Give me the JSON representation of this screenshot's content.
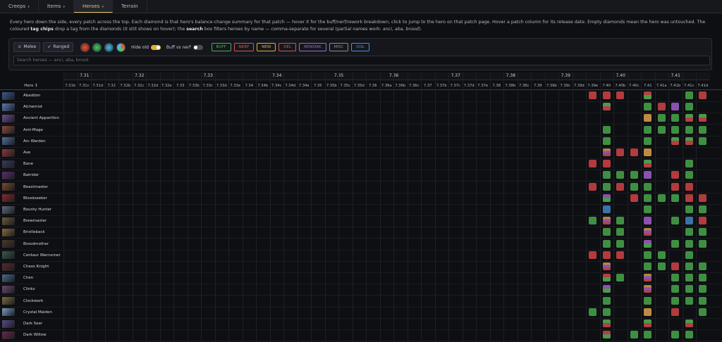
{
  "nav": {
    "tabs": [
      {
        "label": "Creeps",
        "caret": "▾"
      },
      {
        "label": "Items",
        "caret": "▾"
      },
      {
        "label": "Heroes",
        "caret": "▾"
      },
      {
        "label": "Terrain",
        "caret": ""
      }
    ]
  },
  "description": {
    "p1": "Every hero down the side, every patch across the top. Each diamond is that hero's balance-change summary for that patch — hover it for the buff/nerf/rework breakdown, click to jump to the hero on that patch page. Hover a patch column for its release date. Empty diamonds mean the hero was untouched. The coloured",
    "b1": "tag chips",
    "p2": "drop a tag from the diamonds (it still shows on hover); the",
    "b2": "search",
    "p3": "box filters heroes by name — comma-separate for several (partial names work:",
    "examples": "anci, aba, brood",
    "p4": ")."
  },
  "filters": {
    "melee": "Melee",
    "ranged": "Ranged",
    "hide_old": "Hide old",
    "buff_vs_nerf": "Buff vs nerf",
    "chips": [
      {
        "label": "BUFF",
        "color": "#4caf50"
      },
      {
        "label": "NERF",
        "color": "#d9534f"
      },
      {
        "label": "NEW",
        "color": "#e0b030"
      },
      {
        "label": "DEL",
        "color": "#d9534f"
      },
      {
        "label": "REWORK",
        "color": "#9b6bd0"
      },
      {
        "label": "MISC",
        "color": "#8a8d95"
      },
      {
        "label": "QOL",
        "color": "#4a90d9"
      }
    ],
    "search_placeholder": "Search heroes — anci, aba, brood"
  },
  "hero_header": "Hero ↕",
  "majors": [
    "7.31",
    "7.32",
    "7.33",
    "7.34",
    "7.35",
    "7.36",
    "7.37",
    "7.38",
    "7.39",
    "7.40",
    "7.41"
  ],
  "patches": [
    "7.31b",
    "7.31c",
    "7.31d",
    "7.32",
    "7.32b",
    "7.32c",
    "7.32d",
    "7.32e",
    "7.33",
    "7.33b",
    "7.33c",
    "7.33d",
    "7.33e",
    "7.34",
    "7.34b",
    "7.34c",
    "7.34d",
    "7.34e",
    "7.35",
    "7.35b",
    "7.35c",
    "7.35d",
    "7.36",
    "7.36a",
    "7.36b",
    "7.36c",
    "7.37",
    "7.37b",
    "7.37c",
    "7.37d",
    "7.37e",
    "7.38",
    "7.38b",
    "7.38c",
    "7.39",
    "7.39b",
    "7.39c",
    "7.39d",
    "7.39e",
    "7.40",
    "7.40b",
    "7.40c",
    "7.41",
    "7.41a",
    "7.41b",
    "7.41c",
    "7.41d"
  ],
  "heroes": [
    {
      "name": "Abaddon",
      "cells": [
        [
          "7.39e",
          "r"
        ],
        [
          "7.40",
          "r"
        ],
        [
          "7.40b",
          "r"
        ],
        [
          "7.41",
          "rg"
        ],
        [
          "7.41c",
          "g"
        ],
        [
          "7.41d",
          "r"
        ]
      ]
    },
    {
      "name": "Alchemist",
      "cells": [
        [
          "7.40",
          "gr"
        ],
        [
          "7.41",
          "g"
        ],
        [
          "7.41a",
          "r"
        ],
        [
          "7.41b",
          "p"
        ],
        [
          "7.41c",
          "g"
        ]
      ]
    },
    {
      "name": "Ancient Apparition",
      "cells": [
        [
          "7.41",
          "t"
        ],
        [
          "7.41a",
          "g"
        ],
        [
          "7.41b",
          "g"
        ],
        [
          "7.41c",
          "gr"
        ],
        [
          "7.41d",
          "gr"
        ]
      ]
    },
    {
      "name": "Anti-Mage",
      "cells": [
        [
          "7.40",
          "g"
        ],
        [
          "7.41",
          "g"
        ],
        [
          "7.41a",
          "g"
        ],
        [
          "7.41b",
          "g"
        ],
        [
          "7.41c",
          "g"
        ],
        [
          "7.41d",
          "g"
        ]
      ]
    },
    {
      "name": "Arc Warden",
      "cells": [
        [
          "7.40",
          "g"
        ],
        [
          "7.41",
          "g"
        ],
        [
          "7.41b",
          "gr"
        ],
        [
          "7.41c",
          "gr"
        ],
        [
          "7.41d",
          "g"
        ]
      ]
    },
    {
      "name": "Axe",
      "cells": [
        [
          "7.40",
          "tri"
        ],
        [
          "7.40b",
          "r"
        ],
        [
          "7.40c",
          "r"
        ],
        [
          "7.41",
          "t"
        ]
      ]
    },
    {
      "name": "Bane",
      "cells": [
        [
          "7.39e",
          "r"
        ],
        [
          "7.40",
          "r"
        ],
        [
          "7.41",
          "gr"
        ],
        [
          "7.41c",
          "g"
        ]
      ]
    },
    {
      "name": "Batrider",
      "cells": [
        [
          "7.40",
          "g"
        ],
        [
          "7.40b",
          "g"
        ],
        [
          "7.40c",
          "g"
        ],
        [
          "7.41",
          "p"
        ],
        [
          "7.41b",
          "r"
        ],
        [
          "7.41c",
          "g"
        ]
      ]
    },
    {
      "name": "Beastmaster",
      "cells": [
        [
          "7.39e",
          "r"
        ],
        [
          "7.40",
          "g"
        ],
        [
          "7.40b",
          "r"
        ],
        [
          "7.40c",
          "g"
        ],
        [
          "7.41",
          "g"
        ],
        [
          "7.41b",
          "r"
        ],
        [
          "7.41c",
          "r"
        ]
      ]
    },
    {
      "name": "Bloodseeker",
      "cells": [
        [
          "7.40",
          "pg"
        ],
        [
          "7.40c",
          "r"
        ],
        [
          "7.41",
          "g"
        ],
        [
          "7.41a",
          "g"
        ],
        [
          "7.41b",
          "g"
        ],
        [
          "7.41c",
          "r"
        ],
        [
          "7.41d",
          "r"
        ]
      ]
    },
    {
      "name": "Bounty Hunter",
      "cells": [
        [
          "7.40",
          "b"
        ],
        [
          "7.41",
          "g"
        ],
        [
          "7.41c",
          "g"
        ],
        [
          "7.41d",
          "g"
        ]
      ]
    },
    {
      "name": "Brewmaster",
      "cells": [
        [
          "7.39e",
          "g"
        ],
        [
          "7.40",
          "tri"
        ],
        [
          "7.40b",
          "g"
        ],
        [
          "7.41",
          "p"
        ],
        [
          "7.41b",
          "g"
        ],
        [
          "7.41c",
          "b"
        ],
        [
          "7.41d",
          "r"
        ]
      ]
    },
    {
      "name": "Bristleback",
      "cells": [
        [
          "7.40",
          "g"
        ],
        [
          "7.40b",
          "g"
        ],
        [
          "7.41",
          "tri"
        ],
        [
          "7.41c",
          "g"
        ],
        [
          "7.41d",
          "g"
        ]
      ]
    },
    {
      "name": "Broodmother",
      "cells": [
        [
          "7.40",
          "g"
        ],
        [
          "7.40b",
          "g"
        ],
        [
          "7.41",
          "pg"
        ],
        [
          "7.41b",
          "g"
        ],
        [
          "7.41c",
          "g"
        ],
        [
          "7.41d",
          "g"
        ]
      ]
    },
    {
      "name": "Centaur Warrunner",
      "cells": [
        [
          "7.39e",
          "r"
        ],
        [
          "7.40",
          "r"
        ],
        [
          "7.40b",
          "r"
        ],
        [
          "7.41",
          "g"
        ],
        [
          "7.41a",
          "g"
        ],
        [
          "7.41c",
          "g"
        ]
      ]
    },
    {
      "name": "Chaos Knight",
      "cells": [
        [
          "7.40",
          "tri"
        ],
        [
          "7.41",
          "g"
        ],
        [
          "7.41a",
          "g"
        ],
        [
          "7.41b",
          "r"
        ],
        [
          "7.41c",
          "g"
        ],
        [
          "7.41d",
          "g"
        ]
      ]
    },
    {
      "name": "Chen",
      "cells": [
        [
          "7.40",
          "rg"
        ],
        [
          "7.40b",
          "g"
        ],
        [
          "7.41",
          "tri"
        ],
        [
          "7.41b",
          "g"
        ],
        [
          "7.41c",
          "g"
        ],
        [
          "7.41d",
          "g"
        ]
      ]
    },
    {
      "name": "Clinkz",
      "cells": [
        [
          "7.40",
          "pg"
        ],
        [
          "7.41",
          "tri"
        ],
        [
          "7.41b",
          "g"
        ],
        [
          "7.41c",
          "g"
        ],
        [
          "7.41d",
          "g"
        ]
      ]
    },
    {
      "name": "Clockwerk",
      "cells": [
        [
          "7.40",
          "g"
        ],
        [
          "7.41",
          "g"
        ],
        [
          "7.41b",
          "g"
        ],
        [
          "7.41c",
          "g"
        ],
        [
          "7.41d",
          "g"
        ]
      ]
    },
    {
      "name": "Crystal Maiden",
      "cells": [
        [
          "7.39e",
          "g"
        ],
        [
          "7.40",
          "g"
        ],
        [
          "7.41",
          "t"
        ],
        [
          "7.41b",
          "r"
        ],
        [
          "7.41d",
          "g"
        ]
      ]
    },
    {
      "name": "Dark Seer",
      "cells": [
        [
          "7.40",
          "gr"
        ],
        [
          "7.41",
          "gr"
        ],
        [
          "7.41c",
          "gr"
        ]
      ]
    },
    {
      "name": "Dark Willow",
      "cells": [
        [
          "7.40",
          "rg"
        ],
        [
          "7.40c",
          "g"
        ],
        [
          "7.41",
          "g"
        ],
        [
          "7.41b",
          "g"
        ],
        [
          "7.41c",
          "g"
        ]
      ]
    }
  ]
}
